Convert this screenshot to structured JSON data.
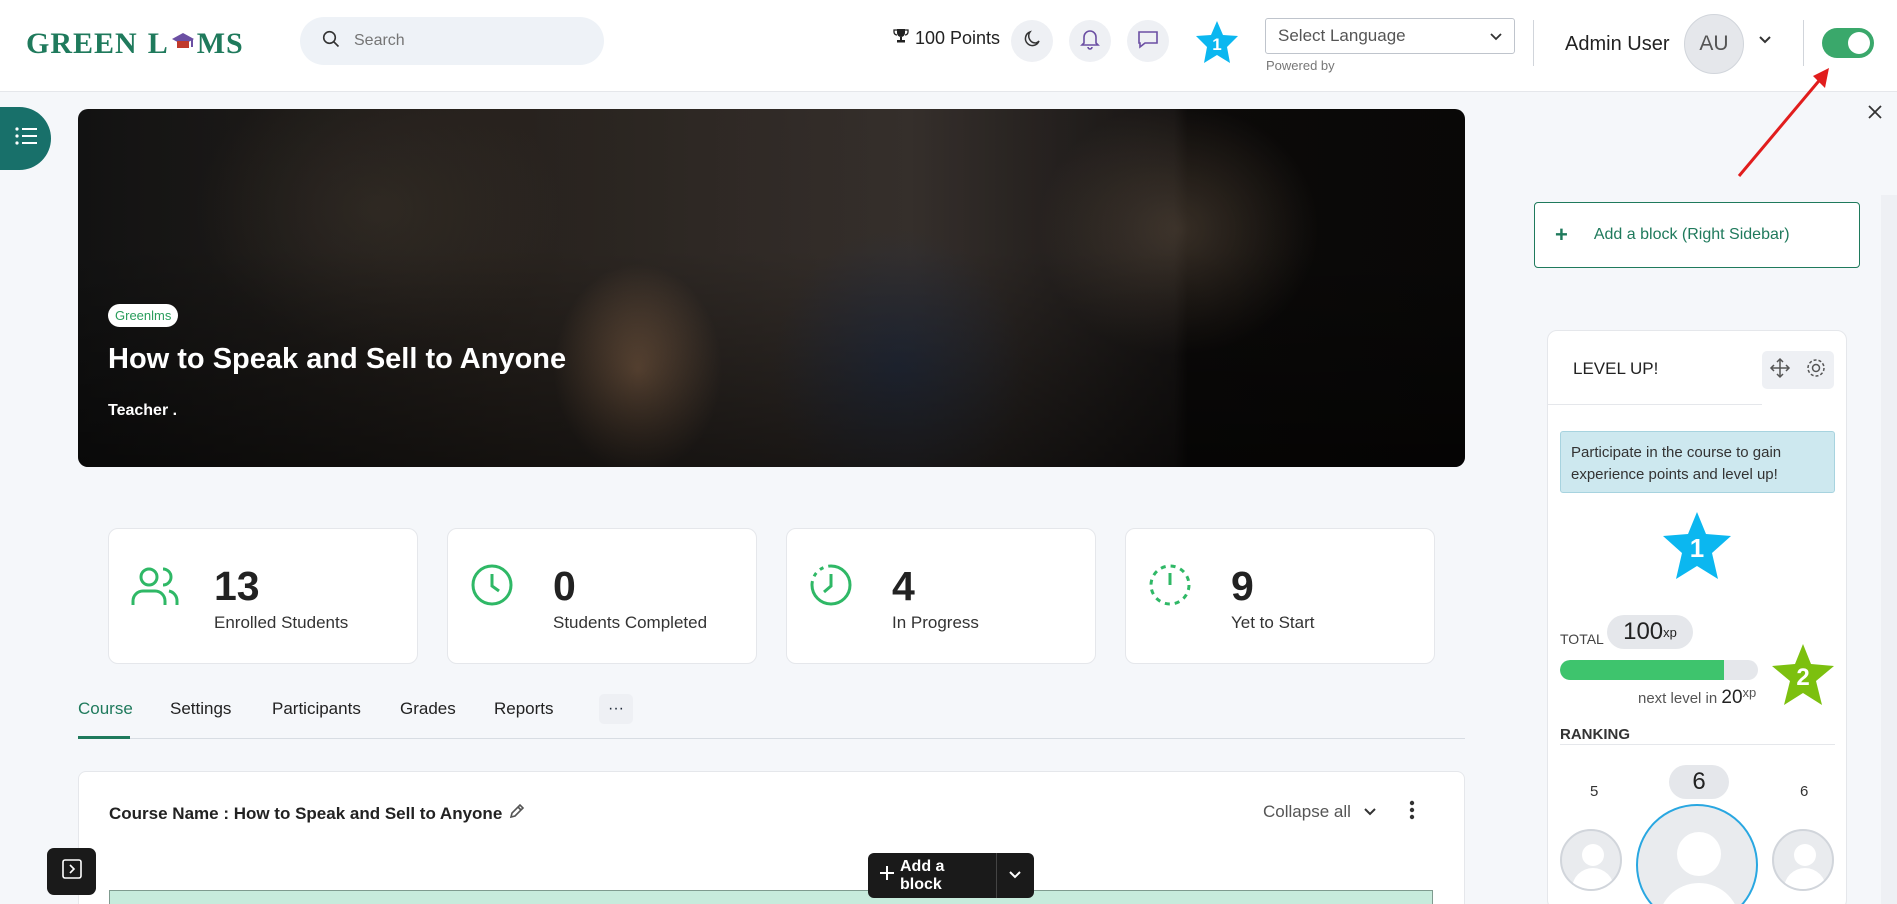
{
  "header": {
    "logo_a": "GREEN",
    "logo_b": "L",
    "logo_c": "MS",
    "search_placeholder": "Search",
    "points": "100 Points",
    "level_badge": "1",
    "language_select": "Select Language",
    "powered_by": "Powered by",
    "user_name": "Admin User",
    "avatar_initials": "AU"
  },
  "hero": {
    "badge": "Greenlms",
    "title": "How to Speak and Sell to Anyone",
    "teacher": "Teacher ."
  },
  "stats": [
    {
      "value": "13",
      "label": "Enrolled Students"
    },
    {
      "value": "0",
      "label": "Students Completed"
    },
    {
      "value": "4",
      "label": "In Progress"
    },
    {
      "value": "9",
      "label": "Yet to Start"
    }
  ],
  "tabs": [
    "Course",
    "Settings",
    "Participants",
    "Grades",
    "Reports"
  ],
  "more_tab": "···",
  "course": {
    "name": "Course Name : How to Speak and Sell to Anyone",
    "collapse_all": "Collapse all",
    "add_block": "Add a block"
  },
  "sidebar": {
    "add_block_right": "Add a block (Right Sidebar)",
    "levelup": {
      "title": "LEVEL UP!",
      "info": "Participate in the course to gain experience points and level up!",
      "current_level": "1",
      "next_level": "2",
      "total_label": "TOTAL",
      "total_xp": "100",
      "xp_unit": "xp",
      "progress_fraction": 0.83,
      "next_level_text": "next level in",
      "next_level_xp": "20",
      "ranking_label": "RANKING",
      "rank_left": "5",
      "rank_center": "6",
      "rank_right": "6"
    }
  },
  "colors": {
    "brand": "#1f7a5c",
    "accent_green": "#3ec46d",
    "star_blue": "#0bb7f0",
    "star_green": "#7cc00f"
  }
}
